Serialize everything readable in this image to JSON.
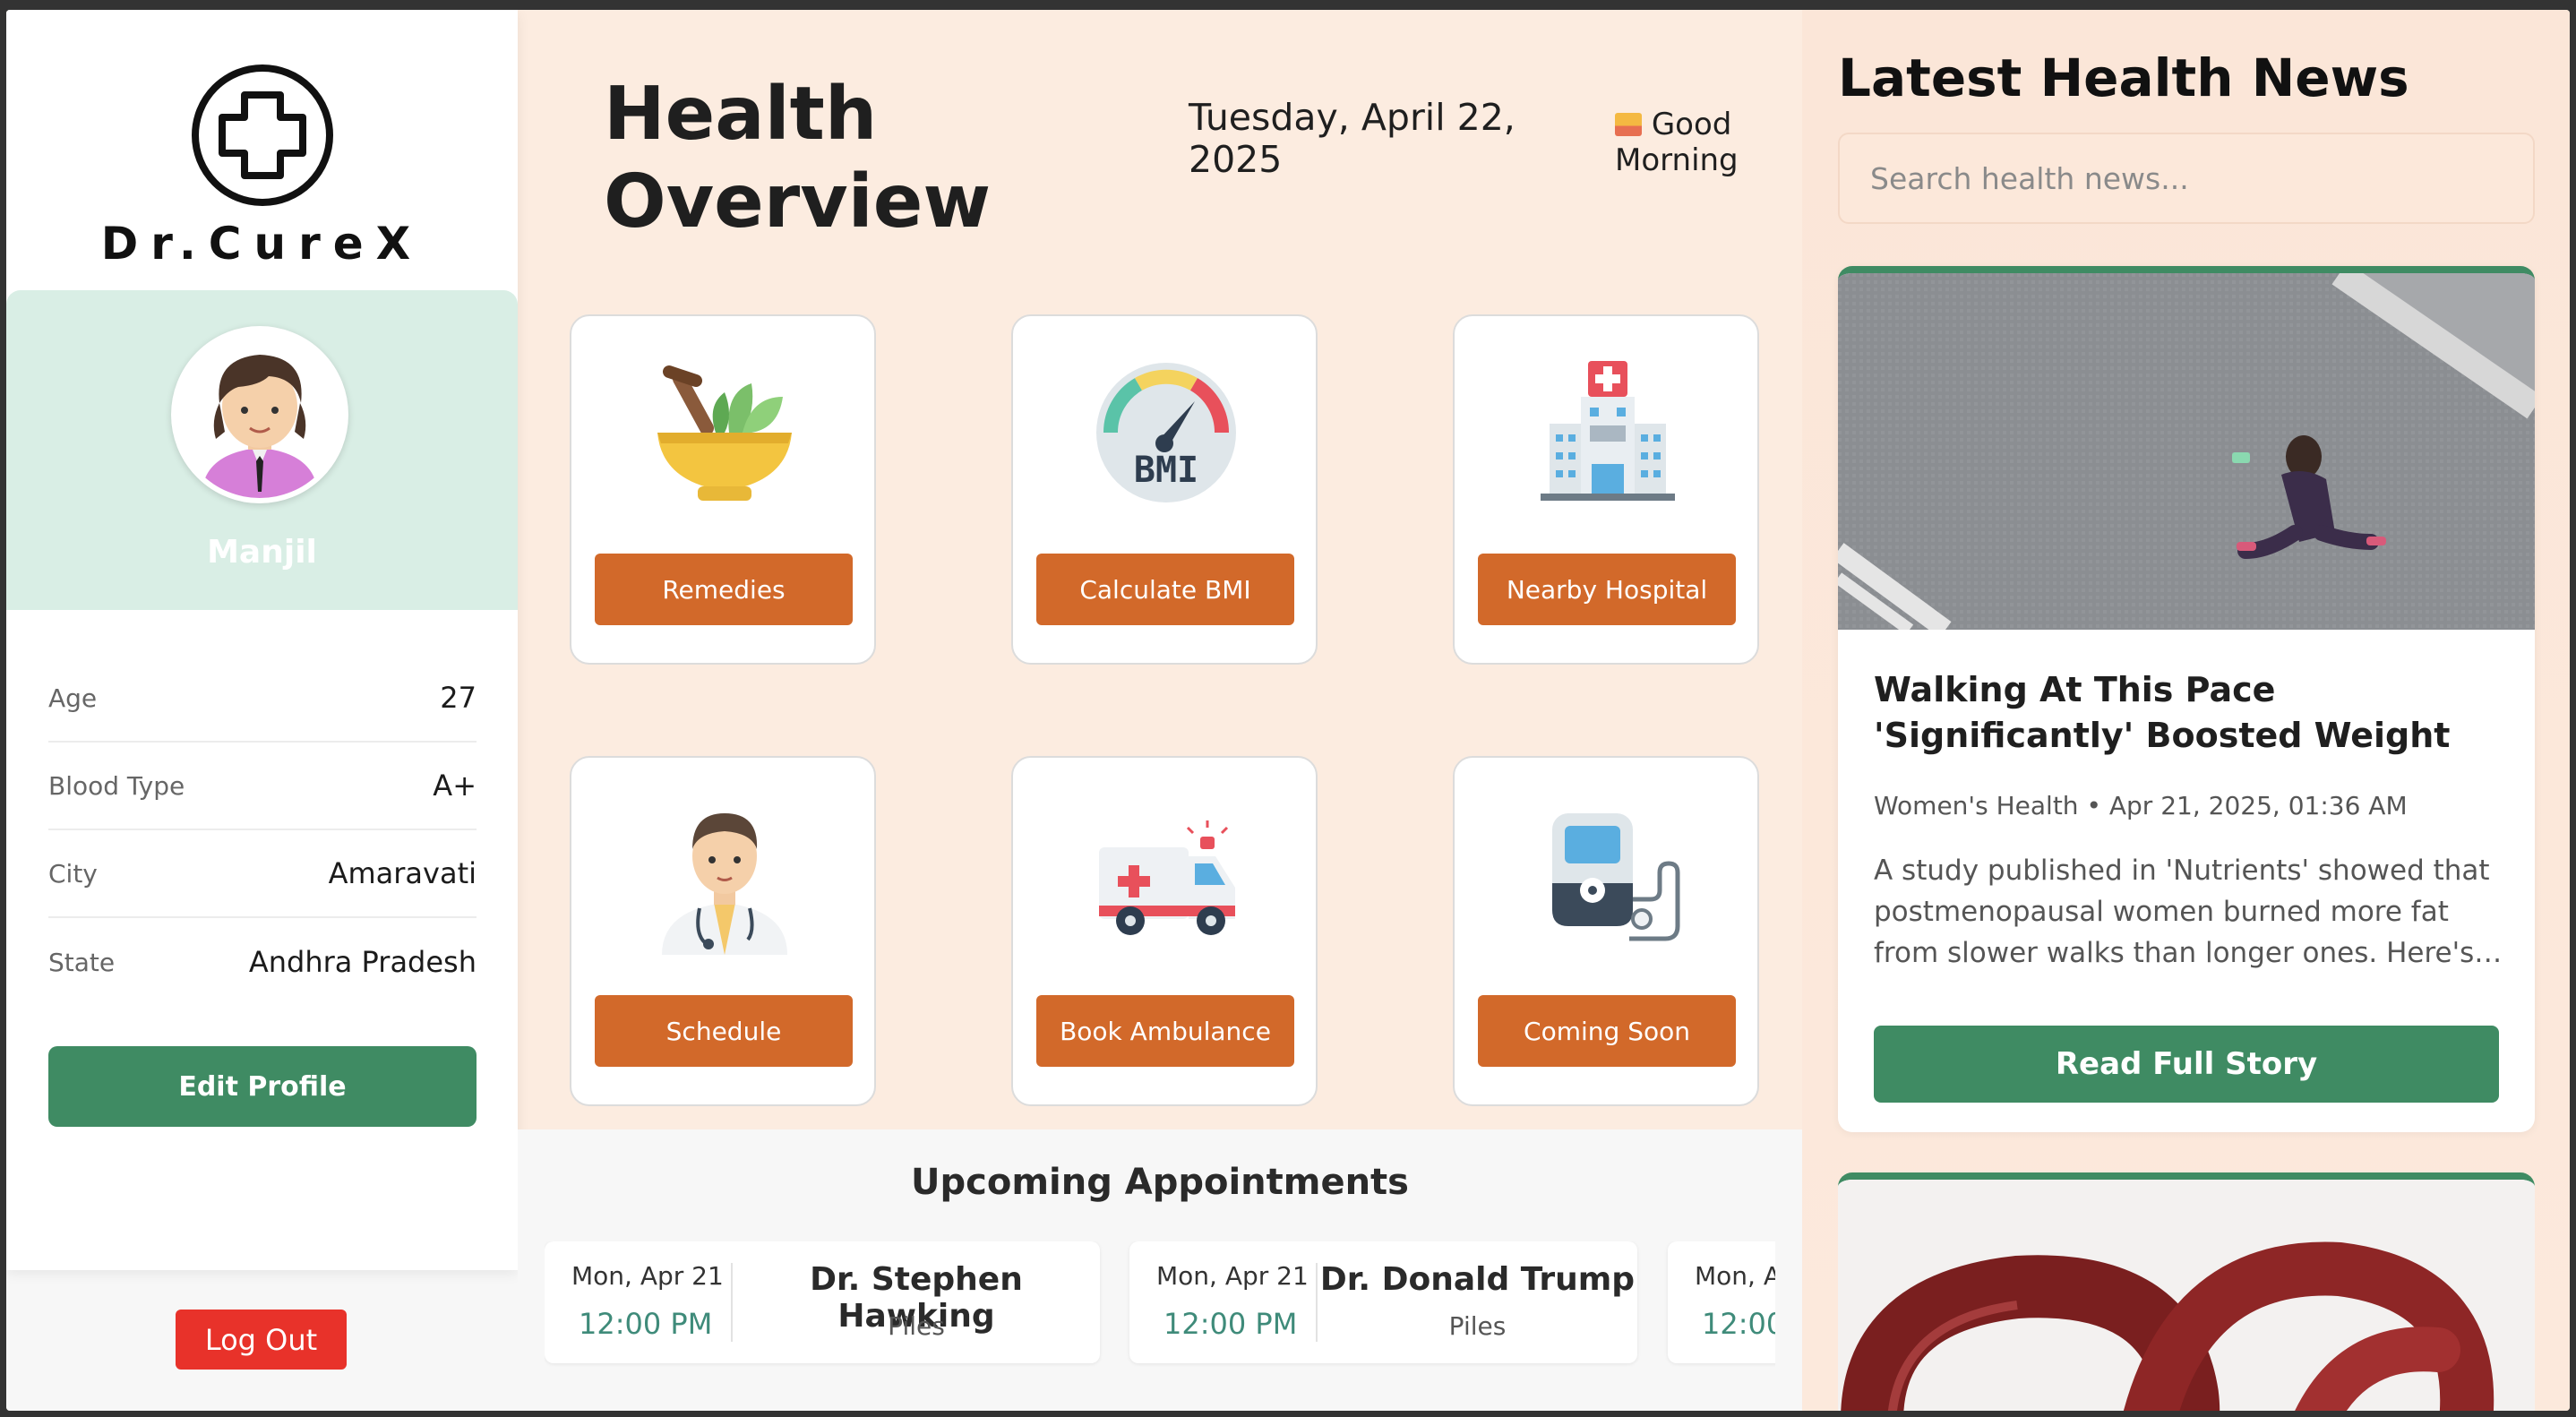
{
  "brand": {
    "name": "Dr.CureX",
    "logo_icon": "medical-cross-icon"
  },
  "profile": {
    "name": "Manjil",
    "fields": [
      {
        "label": "Age",
        "value": "27"
      },
      {
        "label": "Blood Type",
        "value": "A+"
      },
      {
        "label": "City",
        "value": "Amaravati"
      },
      {
        "label": "State",
        "value": "Andhra Pradesh"
      }
    ],
    "edit_label": "Edit Profile",
    "logout_label": "Log Out"
  },
  "header": {
    "title": "Health Overview",
    "date": "Tuesday, April 22, 2025",
    "greeting": "Good Morning",
    "greeting_icon": "sunrise-icon"
  },
  "tiles": [
    {
      "label": "Remedies",
      "icon": "mortar-pestle-icon"
    },
    {
      "label": "Calculate BMI",
      "icon": "bmi-gauge-icon"
    },
    {
      "label": "Nearby Hospital",
      "icon": "hospital-icon"
    },
    {
      "label": "Schedule",
      "icon": "doctor-icon"
    },
    {
      "label": "Book Ambulance",
      "icon": "ambulance-icon"
    },
    {
      "label": "Coming Soon",
      "icon": "bp-monitor-icon"
    }
  ],
  "appointments": {
    "title": "Upcoming Appointments",
    "items": [
      {
        "date": "Mon, Apr 21",
        "time": "12:00 PM",
        "doctor": "Dr. Stephen Hawking",
        "type": "Piles"
      },
      {
        "date": "Mon, Apr 21",
        "time": "12:00 PM",
        "doctor": "Dr. Donald Trump",
        "type": "Piles"
      },
      {
        "date": "Mon, A",
        "time": "12:00",
        "doctor": "",
        "type": ""
      }
    ]
  },
  "news": {
    "title": "Latest Health News",
    "search_placeholder": "Search health news...",
    "articles": [
      {
        "headline": "Walking At This Pace 'Significantly' Boosted Weight Loss In Women Over…",
        "source": "Women's Health",
        "date": "Apr 21, 2025, 01:36 AM",
        "meta": "Women's Health • Apr 21, 2025, 01:36 AM",
        "description": "A study published in 'Nutrients' showed that postmenopausal women burned more fat from slower walks than longer ones. Here's…",
        "cta": "Read Full Story"
      }
    ]
  },
  "colors": {
    "accent_green": "#3f8b63",
    "tile_button": "#d2692a",
    "logout_red": "#e8322a",
    "profile_band": "#d9eee5",
    "main_bg": "#fcece0"
  }
}
